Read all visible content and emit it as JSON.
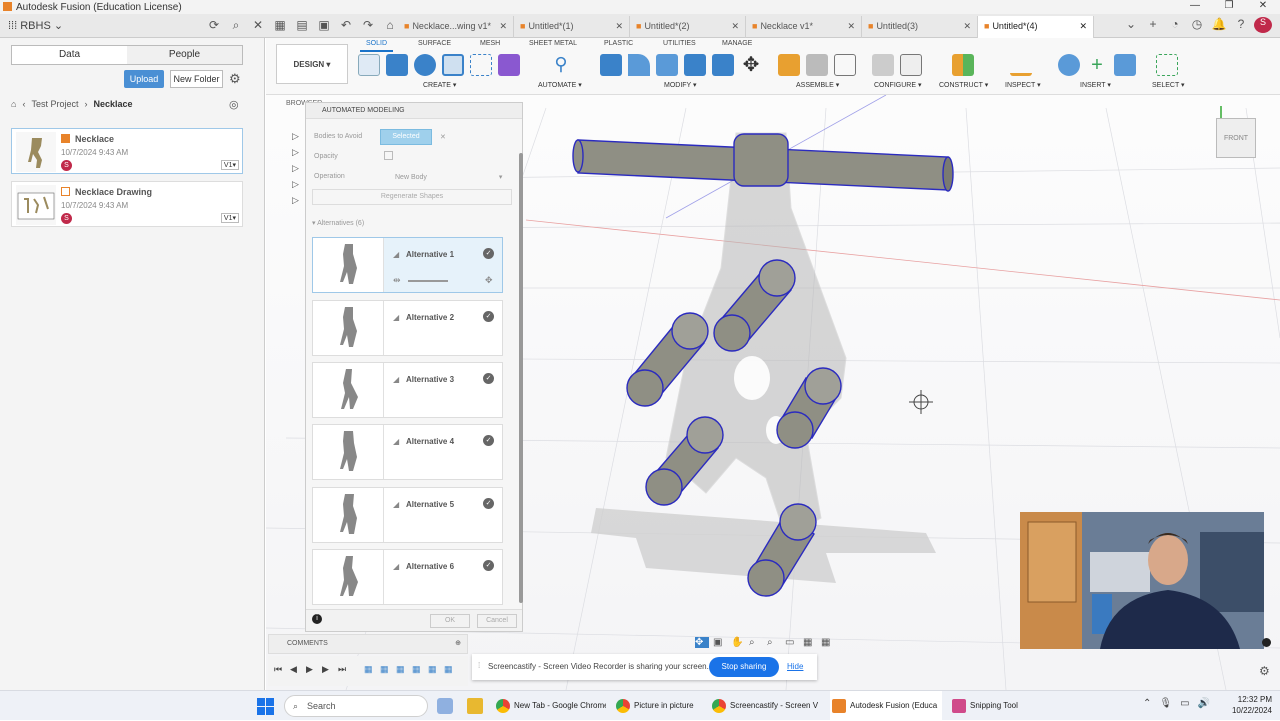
{
  "window": {
    "title": "Autodesk Fusion (Education License)"
  },
  "top": {
    "team": "RBHS",
    "tabs": [
      {
        "label": "Necklace...wing v1*",
        "active": false
      },
      {
        "label": "Untitled*(1)",
        "active": false
      },
      {
        "label": "Untitled*(2)",
        "active": false
      },
      {
        "label": "Necklace v1*",
        "active": false
      },
      {
        "label": "Untitled(3)",
        "active": false
      },
      {
        "label": "Untitled*(4)",
        "active": true
      }
    ]
  },
  "data_panel": {
    "segments": [
      "Data",
      "People"
    ],
    "upload": "Upload",
    "new_folder": "New Folder",
    "breadcrumb": [
      "Test Project",
      "Necklace"
    ],
    "files": [
      {
        "name": "Necklace",
        "date": "10/7/2024 9:43 AM",
        "version": "V1",
        "avatar": "S"
      },
      {
        "name": "Necklace Drawing",
        "date": "10/7/2024 9:43 AM",
        "version": "V1",
        "avatar": "S"
      }
    ]
  },
  "ribbon": {
    "workspace": "DESIGN",
    "tabs": [
      "SOLID",
      "SURFACE",
      "MESH",
      "SHEET METAL",
      "PLASTIC",
      "UTILITIES",
      "MANAGE"
    ],
    "active_tab": "SOLID",
    "groups": [
      "CREATE",
      "AUTOMATE",
      "MODIFY",
      "ASSEMBLE",
      "CONFIGURE",
      "CONSTRUCT",
      "INSPECT",
      "INSERT",
      "SELECT"
    ]
  },
  "browser": {
    "label": "BROWSER"
  },
  "automated_modeling": {
    "title": "AUTOMATED MODELING",
    "bodies_to_avoid_label": "Bodies to Avoid",
    "bodies_to_avoid_value": "Selected",
    "opacity_label": "Opacity",
    "operation_label": "Operation",
    "operation_value": "New Body",
    "regenerate": "Regenerate Shapes",
    "alternatives_header": "Alternatives (6)",
    "alternatives": [
      "Alternative 1",
      "Alternative 2",
      "Alternative 3",
      "Alternative 4",
      "Alternative 5",
      "Alternative 6"
    ],
    "ok": "OK",
    "cancel": "Cancel"
  },
  "comments": {
    "label": "COMMENTS"
  },
  "viewcube": {
    "label": "FRONT"
  },
  "share_bar": {
    "message": "Screencastify - Screen Video Recorder is sharing your screen.",
    "stop": "Stop sharing",
    "hide": "Hide"
  },
  "taskbar": {
    "search": "Search",
    "apps": [
      "New Tab - Google Chrome",
      "Picture in picture",
      "Screencastify - Screen V",
      "Autodesk Fusion (Educa",
      "Snipping Tool"
    ],
    "time": "12:32 PM",
    "date": "10/22/2024"
  },
  "colors": {
    "accent": "#1a73c9",
    "upload": "#4a8fd4",
    "cylinder": "#8f8f84",
    "edge": "#2b2bbf"
  }
}
